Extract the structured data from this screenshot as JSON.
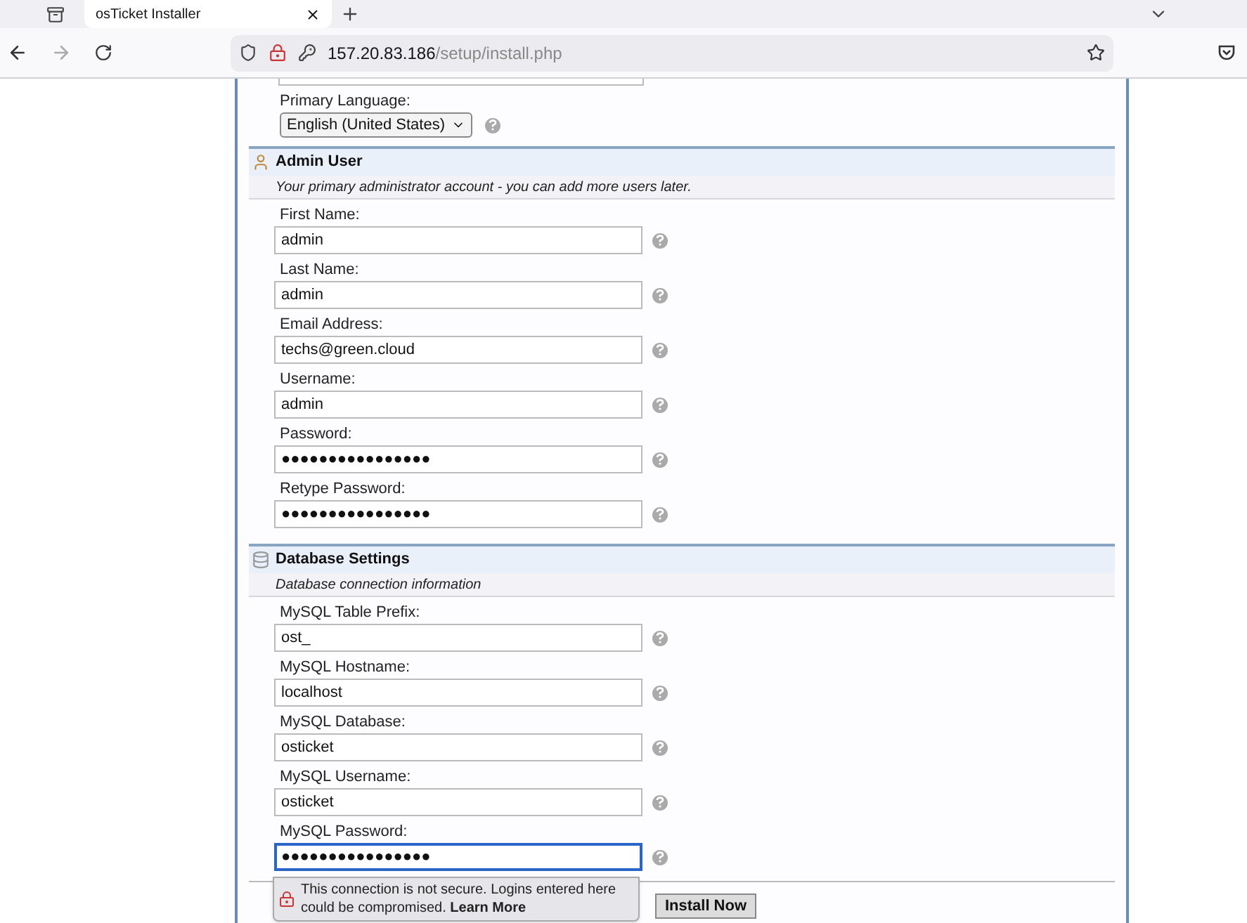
{
  "browser": {
    "tab_title": "osTicket Installer",
    "url_host": "157.20.83.186",
    "url_path": "/setup/install.php"
  },
  "language": {
    "label": "Primary Language:",
    "value": "English (United States)"
  },
  "sections": [
    {
      "kind": "user",
      "title": "Admin User",
      "description": "Your primary administrator account - you can add more users later.",
      "fields": [
        {
          "label": "First Name:",
          "value": "admin",
          "focused": false
        },
        {
          "label": "Last Name:",
          "value": "admin",
          "focused": false
        },
        {
          "label": "Email Address:",
          "value": "techs@green.cloud",
          "focused": false
        },
        {
          "label": "Username:",
          "value": "admin",
          "focused": false
        },
        {
          "label": "Password:",
          "value": "●●●●●●●●●●●●●●●●",
          "focused": false
        },
        {
          "label": "Retype Password:",
          "value": "●●●●●●●●●●●●●●●●",
          "focused": false
        }
      ]
    },
    {
      "kind": "database",
      "title": "Database Settings",
      "description": "Database connection information",
      "fields": [
        {
          "label": "MySQL Table Prefix:",
          "value": "ost_",
          "focused": false
        },
        {
          "label": "MySQL Hostname:",
          "value": "localhost",
          "focused": false
        },
        {
          "label": "MySQL Database:",
          "value": "osticket",
          "focused": false
        },
        {
          "label": "MySQL Username:",
          "value": "osticket",
          "focused": false
        },
        {
          "label": "MySQL Password:",
          "value": "●●●●●●●●●●●●●●●●",
          "focused": true
        }
      ]
    }
  ],
  "warning": {
    "text": "This connection is not secure. Logins entered here could be compromised.",
    "link": "Learn More"
  },
  "install_button": "Install Now"
}
